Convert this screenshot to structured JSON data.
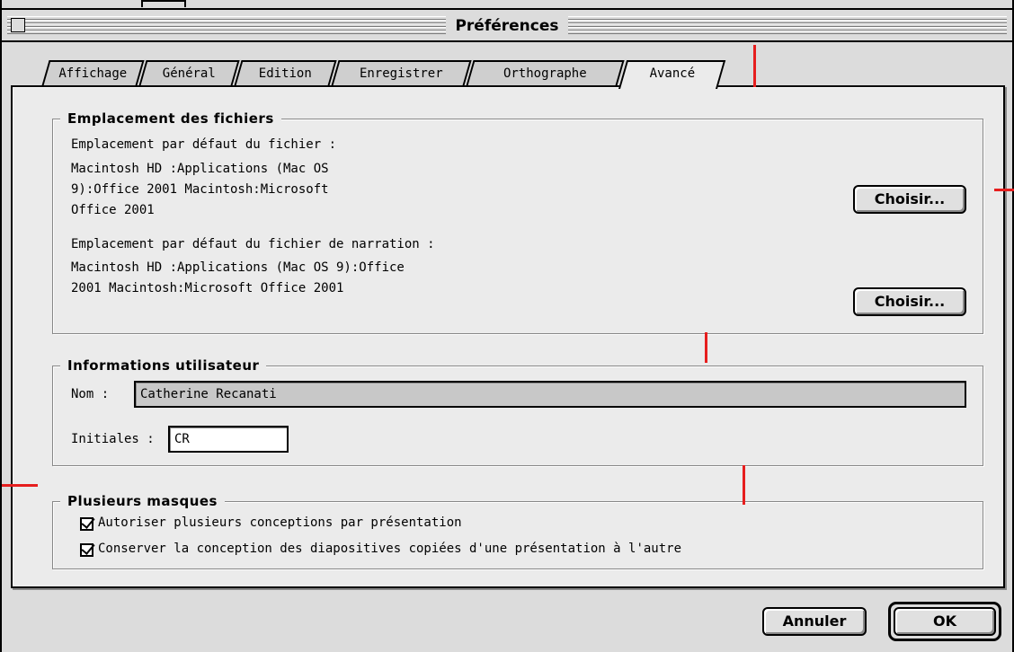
{
  "window": {
    "title": "Préférences"
  },
  "tabs": [
    {
      "label": "Affichage"
    },
    {
      "label": "Général"
    },
    {
      "label": "Edition"
    },
    {
      "label": "Enregistrer"
    },
    {
      "label": "Orthographe"
    },
    {
      "label": "Avancé",
      "active": true
    }
  ],
  "files": {
    "legend": "Emplacement des fichiers",
    "default_label": "Emplacement par défaut du fichier  :",
    "default_path": [
      "Macintosh HD :Applications (Mac OS",
      "9):Office 2001 Macintosh:Microsoft",
      "Office 2001"
    ],
    "narration_label": "Emplacement par défaut du fichier de narration  :",
    "narration_path": [
      "Macintosh HD :Applications (Mac OS 9):Office",
      "2001 Macintosh:Microsoft Office 2001"
    ],
    "choose_label": "Choisir..."
  },
  "user": {
    "legend": "Informations utilisateur",
    "name_label": "Nom  :",
    "name_value": "Catherine Recanati",
    "initials_label": "Initiales  :",
    "initials_value": "CR"
  },
  "masters": {
    "legend": "Plusieurs masques",
    "option1": "Autoriser plusieurs conceptions par présentation",
    "option1_checked": true,
    "option2": "Conserver la conception des diapositives copiées d'une présentation à l'autre",
    "option2_checked": true
  },
  "footer": {
    "cancel_label": "Annuler",
    "ok_label": "OK"
  },
  "colors": {
    "annotation": "#e61e1e",
    "panel": "#ebebeb",
    "chrome": "#dcdcdc"
  }
}
